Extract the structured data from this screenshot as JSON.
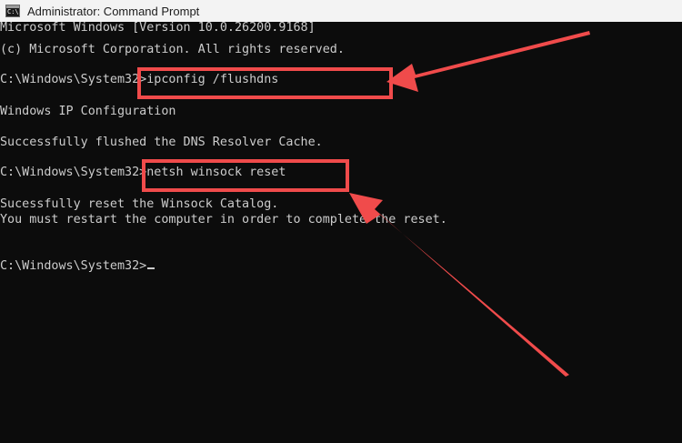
{
  "window": {
    "title": "Administrator: Command Prompt",
    "icon": "cmd-icon",
    "icon_prompt": "C:\\"
  },
  "console": {
    "lines": [
      "Microsoft Windows [Version 10.0.26200.9168]",
      "(c) Microsoft Corporation. All rights reserved.",
      "",
      "C:\\Windows\\System32>ipconfig /flushdns",
      "",
      "Windows IP Configuration",
      "",
      "Successfully flushed the DNS Resolver Cache.",
      "",
      "C:\\Windows\\System32>netsh winsock reset",
      "",
      "Sucessfully reset the Winsock Catalog.",
      "You must restart the computer in order to complete the reset.",
      "",
      "",
      "C:\\Windows\\System32>"
    ]
  },
  "annotations": {
    "color": "#f04b4b",
    "items": [
      "highlight-box",
      "arrow"
    ]
  }
}
